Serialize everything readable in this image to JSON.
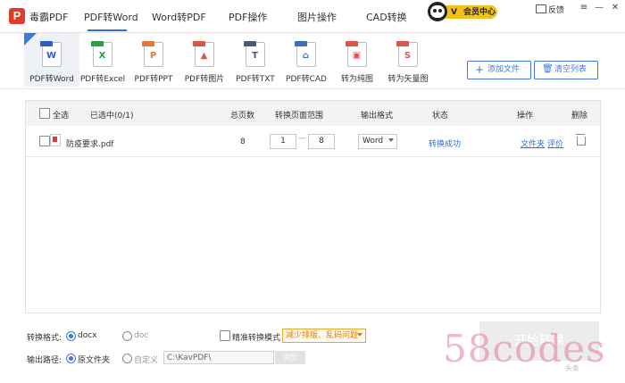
{
  "header": {
    "app_name": "毒霸PDF",
    "logo_letter": "P",
    "tabs": [
      "PDF转Word",
      "Word转PDF",
      "PDF操作",
      "图片操作",
      "CAD转换"
    ],
    "active_tab": "PDF转Word",
    "vip_label": "会员中心",
    "feedback_label": "反馈",
    "window_controls": [
      "≡",
      "—",
      "✕"
    ]
  },
  "toolbar": {
    "tools": [
      {
        "label": "PDF转Word",
        "icon": "word-doc-icon",
        "color": "#2b5fc4",
        "glyph": "W"
      },
      {
        "label": "PDF转Excel",
        "icon": "excel-doc-icon",
        "color": "#2e9a4a",
        "glyph": "X"
      },
      {
        "label": "PDF转PPT",
        "icon": "ppt-doc-icon",
        "color": "#e4763a",
        "glyph": "P"
      },
      {
        "label": "PDF转图片",
        "icon": "image-doc-icon",
        "color": "#e0534a",
        "glyph": "▲"
      },
      {
        "label": "PDF转TXT",
        "icon": "txt-doc-icon",
        "color": "#4a5a78",
        "glyph": "T"
      },
      {
        "label": "PDF转CAD",
        "icon": "cad-doc-icon",
        "color": "#3d6fb8",
        "glyph": "⌂"
      },
      {
        "label": "转为纯图",
        "icon": "pure-image-icon",
        "color": "#e0534a",
        "glyph": "▣"
      },
      {
        "label": "转为矢量图",
        "icon": "vector-image-icon",
        "color": "#e0534a",
        "glyph": "S"
      }
    ],
    "add_file_label": "添加文件",
    "clear_list_label": "清空列表"
  },
  "table": {
    "select_all_label": "全选",
    "selected_count_label": "已选中(0/1)",
    "columns": {
      "total_pages": "总页数",
      "page_range": "转换页面范围",
      "output_format": "输出格式",
      "status": "状态",
      "actions": "操作",
      "delete": "删除"
    },
    "rows": [
      {
        "file_name": "防疫要求.pdf",
        "total_pages": "8",
        "range_from": "1",
        "range_to": "8",
        "output_format": "Word",
        "status": "转换成功",
        "action_folder": "文件夹",
        "action_rate": "评价"
      }
    ]
  },
  "options": {
    "format_label": "转换格式:",
    "format_docx": "docx",
    "format_doc": "doc",
    "format_selected": "docx",
    "precise_mode_label": "精准转换模式",
    "precise_mode_hint": "减少排版、乱码问题",
    "output_path_label": "输出路径:",
    "path_original": "原文件夹",
    "path_custom": "自定义",
    "path_selected": "原文件夹",
    "path_value": "C:\\KavPDF\\",
    "browse_label": "浏览",
    "start_label": "开始转换"
  },
  "watermark": {
    "text": "58codes",
    "small_text": "头条"
  },
  "colors": {
    "accent": "#2f6fd6",
    "logo_red": "#e23b2e",
    "vip_yellow": "#f2c21b",
    "hint_orange": "#e07a00"
  }
}
